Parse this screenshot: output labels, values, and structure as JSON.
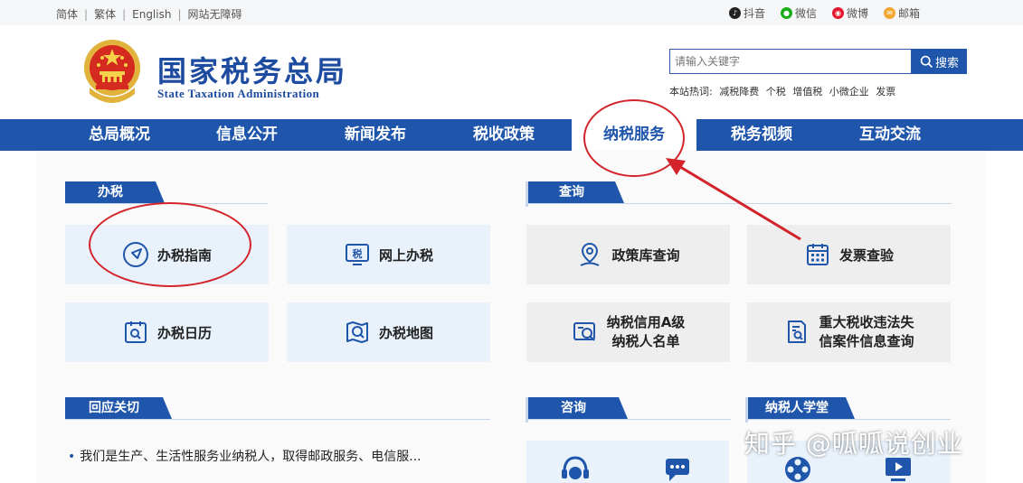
{
  "topbar": {
    "lang": [
      "简体",
      "繁体",
      "English",
      "网站无障碍"
    ],
    "social": [
      {
        "label": "抖音",
        "icon": "douyin-icon",
        "color": "#222222"
      },
      {
        "label": "微信",
        "icon": "wechat-icon",
        "color": "#1aad19"
      },
      {
        "label": "微博",
        "icon": "weibo-icon",
        "color": "#e6162d"
      },
      {
        "label": "邮箱",
        "icon": "mail-icon",
        "color": "#f0a830"
      }
    ]
  },
  "header": {
    "title_cn": "国家税务总局",
    "title_en": "State Taxation Administration",
    "brand_color": "#1f56ab"
  },
  "search": {
    "placeholder": "请输入关键字",
    "button_label": "搜索",
    "hot_label": "本站热词:",
    "hot_terms": [
      "减税降费",
      "个税",
      "增值税",
      "小微企业",
      "发票"
    ]
  },
  "nav": {
    "items": [
      "总局概况",
      "信息公开",
      "新闻发布",
      "税收政策",
      "纳税服务",
      "税务视频",
      "互动交流"
    ],
    "active_index": 4
  },
  "sections": {
    "banshui": {
      "title": "办税",
      "tiles": [
        {
          "label": "办税指南",
          "icon": "compass-icon"
        },
        {
          "label": "网上办税",
          "icon": "tax-screen-icon",
          "icon_text": "税"
        },
        {
          "label": "办税日历",
          "icon": "calendar-search-icon"
        },
        {
          "label": "办税地图",
          "icon": "map-search-icon"
        }
      ]
    },
    "chaxun": {
      "title": "查询",
      "tiles": [
        {
          "label": "政策库查询",
          "icon": "location-person-icon"
        },
        {
          "label": "发票查验",
          "icon": "calendar-grid-icon"
        },
        {
          "label_line1": "纳税信用A级",
          "label_line2": "纳税人名单",
          "icon": "credit-search-icon"
        },
        {
          "label_line1": "重大税收违法失",
          "label_line2": "信案件信息查询",
          "icon": "document-search-icon"
        }
      ]
    },
    "huiying": {
      "title": "回应关切",
      "items": [
        "我们是生产、生活性服务业纳税人，取得邮政服务、电信服..."
      ]
    },
    "zixun": {
      "title": "咨询"
    },
    "nsrxt": {
      "title": "纳税人学堂"
    }
  },
  "watermark": "知乎 @呱呱说创业",
  "annotation_color": "#d3242b"
}
